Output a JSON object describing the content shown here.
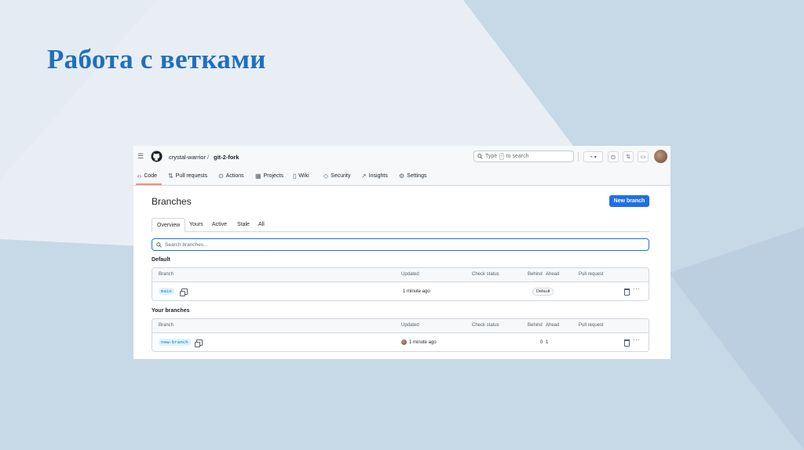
{
  "slide": {
    "title": "Работа с ветками"
  },
  "header": {
    "owner": "crystal-warrior",
    "separator": "/",
    "repo": "git-2-fork",
    "search_prefix": "Type",
    "search_key": "/",
    "search_suffix": "to search",
    "plus_label": "+ ▾"
  },
  "nav_tabs": [
    "Code",
    "Pull requests",
    "Actions",
    "Projects",
    "Wiki",
    "Security",
    "Insights",
    "Settings"
  ],
  "page": {
    "title": "Branches",
    "new_branch_label": "New branch",
    "branch_tabs": [
      "Overview",
      "Yours",
      "Active",
      "Stale",
      "All"
    ],
    "search_placeholder": "Search branches..."
  },
  "columns": [
    "Branch",
    "Updated",
    "Check status",
    "Behind",
    "Ahead",
    "Pull request"
  ],
  "default_section": {
    "heading": "Default",
    "row": {
      "branch": "main",
      "updated": "1 minute ago",
      "badge": "Default"
    }
  },
  "your_section": {
    "heading": "Your branches",
    "row": {
      "branch": "new-branch",
      "updated": "1 minute ago",
      "behind": "0",
      "ahead": "1"
    }
  },
  "colors": {
    "accent": "#1f6feb",
    "title": "#1f6fbf",
    "tab_underline": "#fd8c73"
  }
}
